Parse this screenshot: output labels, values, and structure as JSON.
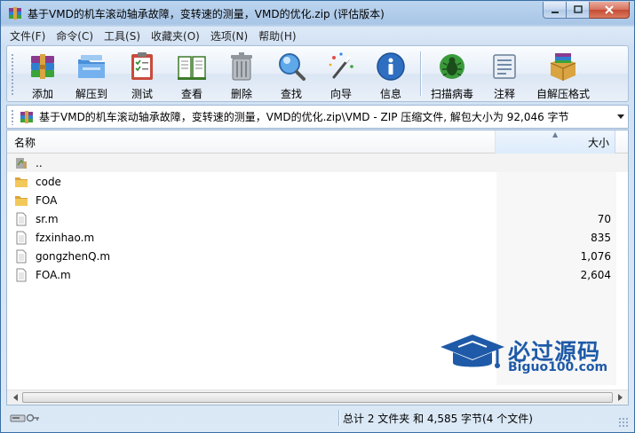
{
  "window": {
    "title": "基于VMD的机车滚动轴承故障，变转速的测量，VMD的优化.zip (评估版本)"
  },
  "menu": [
    {
      "label": "文件(F)"
    },
    {
      "label": "命令(C)"
    },
    {
      "label": "工具(S)"
    },
    {
      "label": "收藏夹(O)"
    },
    {
      "label": "选项(N)"
    },
    {
      "label": "帮助(H)"
    }
  ],
  "toolbar": {
    "add": "添加",
    "extract": "解压到",
    "test": "测试",
    "view": "查看",
    "delete": "删除",
    "find": "查找",
    "wizard": "向导",
    "info": "信息",
    "virus_scan": "扫描病毒",
    "comment": "注释",
    "sfx": "自解压格式"
  },
  "address": {
    "path": "基于VMD的机车滚动轴承故障，变转速的测量，VMD的优化.zip\\VMD - ZIP 压缩文件, 解包大小为 92,046 字节"
  },
  "list": {
    "columns": {
      "name": "名称",
      "size": "大小"
    },
    "rows": [
      {
        "name": "..",
        "size": "",
        "kind": "parent"
      },
      {
        "name": "code",
        "size": "",
        "kind": "folder"
      },
      {
        "name": "FOA",
        "size": "",
        "kind": "folder"
      },
      {
        "name": "sr.m",
        "size": "70",
        "kind": "file"
      },
      {
        "name": "fzxinhao.m",
        "size": "835",
        "kind": "file"
      },
      {
        "name": "gongzhenQ.m",
        "size": "1,076",
        "kind": "file"
      },
      {
        "name": "FOA.m",
        "size": "2,604",
        "kind": "file"
      }
    ]
  },
  "watermark": {
    "text": "必过源码",
    "sub": "Biguo100.com"
  },
  "status": {
    "summary": "总计 2 文件夹 和 4,585 字节(4 个文件)"
  },
  "colors": {
    "accent": "#1e5aa8",
    "folder": "#e8b73d"
  }
}
